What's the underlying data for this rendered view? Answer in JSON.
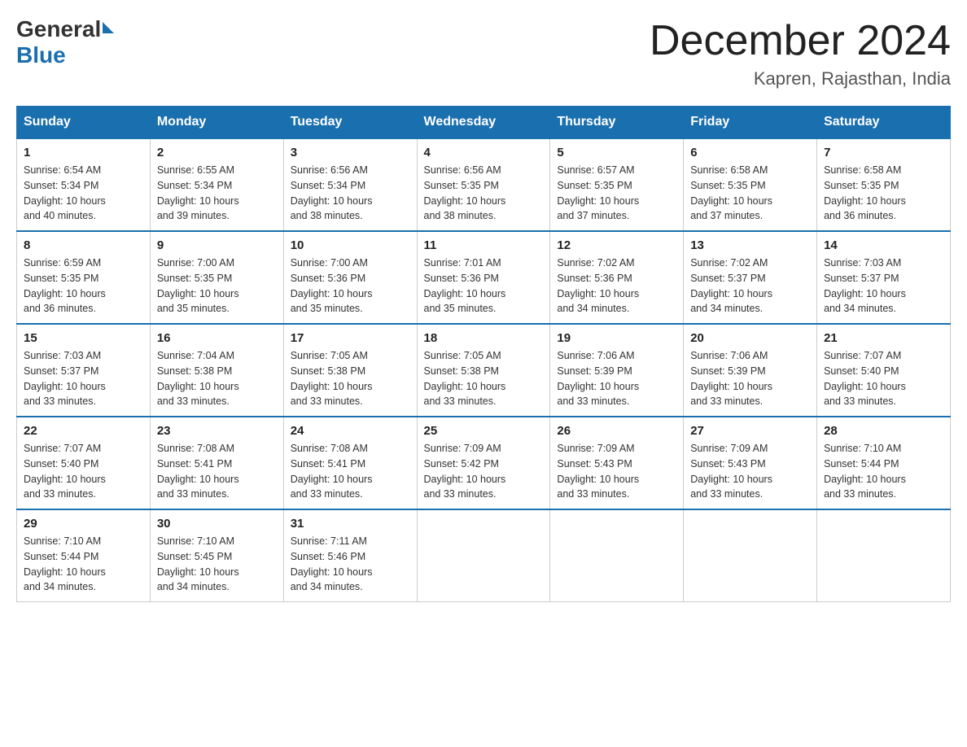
{
  "header": {
    "logo": {
      "general": "General",
      "blue": "Blue"
    },
    "title": "December 2024",
    "location": "Kapren, Rajasthan, India"
  },
  "weekdays": [
    "Sunday",
    "Monday",
    "Tuesday",
    "Wednesday",
    "Thursday",
    "Friday",
    "Saturday"
  ],
  "weeks": [
    [
      {
        "day": "1",
        "sunrise": "6:54 AM",
        "sunset": "5:34 PM",
        "daylight": "10 hours and 40 minutes."
      },
      {
        "day": "2",
        "sunrise": "6:55 AM",
        "sunset": "5:34 PM",
        "daylight": "10 hours and 39 minutes."
      },
      {
        "day": "3",
        "sunrise": "6:56 AM",
        "sunset": "5:34 PM",
        "daylight": "10 hours and 38 minutes."
      },
      {
        "day": "4",
        "sunrise": "6:56 AM",
        "sunset": "5:35 PM",
        "daylight": "10 hours and 38 minutes."
      },
      {
        "day": "5",
        "sunrise": "6:57 AM",
        "sunset": "5:35 PM",
        "daylight": "10 hours and 37 minutes."
      },
      {
        "day": "6",
        "sunrise": "6:58 AM",
        "sunset": "5:35 PM",
        "daylight": "10 hours and 37 minutes."
      },
      {
        "day": "7",
        "sunrise": "6:58 AM",
        "sunset": "5:35 PM",
        "daylight": "10 hours and 36 minutes."
      }
    ],
    [
      {
        "day": "8",
        "sunrise": "6:59 AM",
        "sunset": "5:35 PM",
        "daylight": "10 hours and 36 minutes."
      },
      {
        "day": "9",
        "sunrise": "7:00 AM",
        "sunset": "5:35 PM",
        "daylight": "10 hours and 35 minutes."
      },
      {
        "day": "10",
        "sunrise": "7:00 AM",
        "sunset": "5:36 PM",
        "daylight": "10 hours and 35 minutes."
      },
      {
        "day": "11",
        "sunrise": "7:01 AM",
        "sunset": "5:36 PM",
        "daylight": "10 hours and 35 minutes."
      },
      {
        "day": "12",
        "sunrise": "7:02 AM",
        "sunset": "5:36 PM",
        "daylight": "10 hours and 34 minutes."
      },
      {
        "day": "13",
        "sunrise": "7:02 AM",
        "sunset": "5:37 PM",
        "daylight": "10 hours and 34 minutes."
      },
      {
        "day": "14",
        "sunrise": "7:03 AM",
        "sunset": "5:37 PM",
        "daylight": "10 hours and 34 minutes."
      }
    ],
    [
      {
        "day": "15",
        "sunrise": "7:03 AM",
        "sunset": "5:37 PM",
        "daylight": "10 hours and 33 minutes."
      },
      {
        "day": "16",
        "sunrise": "7:04 AM",
        "sunset": "5:38 PM",
        "daylight": "10 hours and 33 minutes."
      },
      {
        "day": "17",
        "sunrise": "7:05 AM",
        "sunset": "5:38 PM",
        "daylight": "10 hours and 33 minutes."
      },
      {
        "day": "18",
        "sunrise": "7:05 AM",
        "sunset": "5:38 PM",
        "daylight": "10 hours and 33 minutes."
      },
      {
        "day": "19",
        "sunrise": "7:06 AM",
        "sunset": "5:39 PM",
        "daylight": "10 hours and 33 minutes."
      },
      {
        "day": "20",
        "sunrise": "7:06 AM",
        "sunset": "5:39 PM",
        "daylight": "10 hours and 33 minutes."
      },
      {
        "day": "21",
        "sunrise": "7:07 AM",
        "sunset": "5:40 PM",
        "daylight": "10 hours and 33 minutes."
      }
    ],
    [
      {
        "day": "22",
        "sunrise": "7:07 AM",
        "sunset": "5:40 PM",
        "daylight": "10 hours and 33 minutes."
      },
      {
        "day": "23",
        "sunrise": "7:08 AM",
        "sunset": "5:41 PM",
        "daylight": "10 hours and 33 minutes."
      },
      {
        "day": "24",
        "sunrise": "7:08 AM",
        "sunset": "5:41 PM",
        "daylight": "10 hours and 33 minutes."
      },
      {
        "day": "25",
        "sunrise": "7:09 AM",
        "sunset": "5:42 PM",
        "daylight": "10 hours and 33 minutes."
      },
      {
        "day": "26",
        "sunrise": "7:09 AM",
        "sunset": "5:43 PM",
        "daylight": "10 hours and 33 minutes."
      },
      {
        "day": "27",
        "sunrise": "7:09 AM",
        "sunset": "5:43 PM",
        "daylight": "10 hours and 33 minutes."
      },
      {
        "day": "28",
        "sunrise": "7:10 AM",
        "sunset": "5:44 PM",
        "daylight": "10 hours and 33 minutes."
      }
    ],
    [
      {
        "day": "29",
        "sunrise": "7:10 AM",
        "sunset": "5:44 PM",
        "daylight": "10 hours and 34 minutes."
      },
      {
        "day": "30",
        "sunrise": "7:10 AM",
        "sunset": "5:45 PM",
        "daylight": "10 hours and 34 minutes."
      },
      {
        "day": "31",
        "sunrise": "7:11 AM",
        "sunset": "5:46 PM",
        "daylight": "10 hours and 34 minutes."
      },
      null,
      null,
      null,
      null
    ]
  ],
  "labels": {
    "sunrise": "Sunrise:",
    "sunset": "Sunset:",
    "daylight": "Daylight:"
  }
}
